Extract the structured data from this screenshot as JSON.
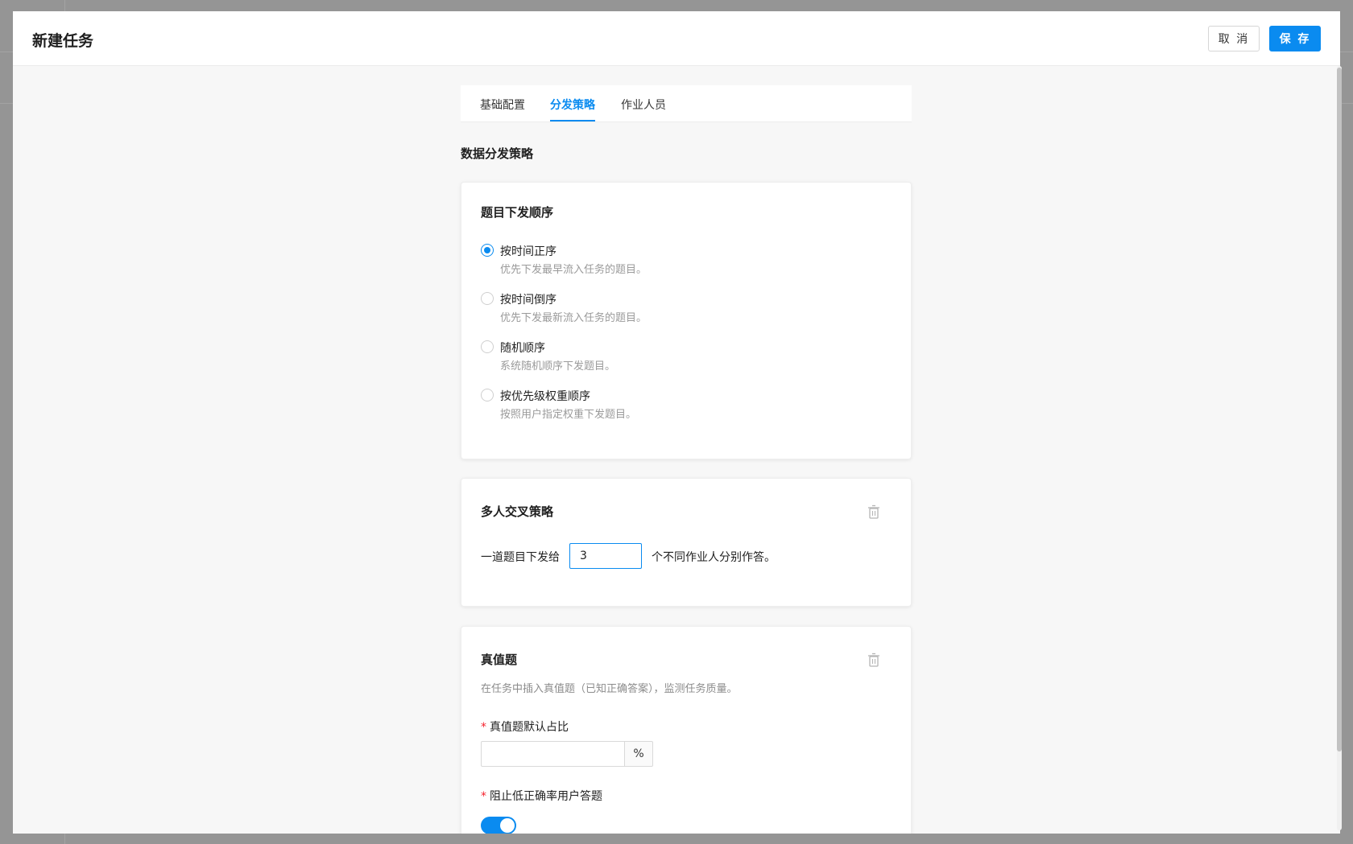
{
  "modal": {
    "title": "新建任务",
    "cancel_label": "取 消",
    "save_label": "保 存"
  },
  "tabs": [
    {
      "label": "基础配置",
      "active": false
    },
    {
      "label": "分发策略",
      "active": true
    },
    {
      "label": "作业人员",
      "active": false
    }
  ],
  "section_title": "数据分发策略",
  "order_card": {
    "title": "题目下发顺序",
    "options": [
      {
        "label": "按时间正序",
        "desc": "优先下发最早流入任务的题目。",
        "checked": true
      },
      {
        "label": "按时间倒序",
        "desc": "优先下发最新流入任务的题目。",
        "checked": false
      },
      {
        "label": "随机顺序",
        "desc": "系统随机顺序下发题目。",
        "checked": false
      },
      {
        "label": "按优先级权重顺序",
        "desc": "按照用户指定权重下发题目。",
        "checked": false
      }
    ]
  },
  "cross_card": {
    "title": "多人交叉策略",
    "prefix": "一道题目下发给",
    "value": "3",
    "suffix": "个不同作业人分别作答。",
    "delete_icon": "trash-icon"
  },
  "truth_card": {
    "title": "真值题",
    "desc": "在任务中插入真值题（已知正确答案），监测任务质量。",
    "ratio_label": "真值题默认占比",
    "ratio_value": "",
    "ratio_unit": "%",
    "block_label": "阻止低正确率用户答题",
    "block_enabled": true,
    "required_mark": "*",
    "delete_icon": "trash-icon"
  },
  "colors": {
    "primary": "#0a8bf0",
    "required": "#f5222d"
  }
}
